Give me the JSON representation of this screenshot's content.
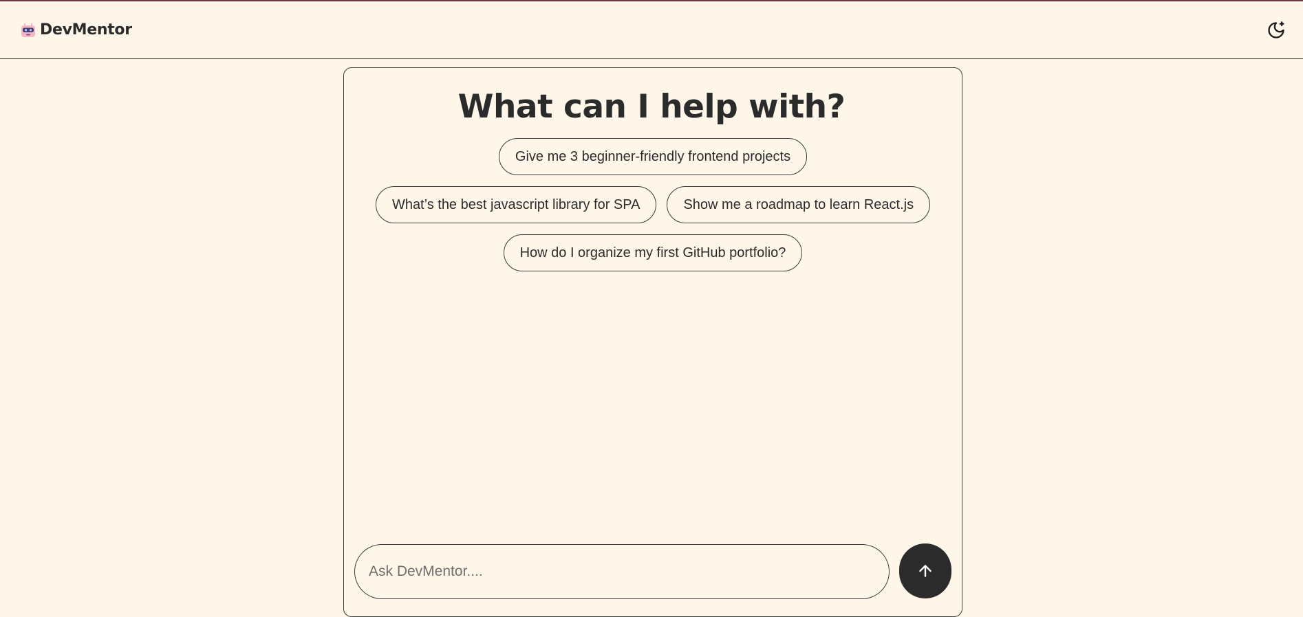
{
  "app": {
    "name": "DevMentor",
    "logo_icon": "robot-icon",
    "theme_toggle_icon": "moon-stars-icon"
  },
  "main": {
    "heading": "What can I help with?",
    "suggestions": [
      [
        "Give me 3 beginner-friendly frontend projects"
      ],
      [
        "What’s the best javascript library for SPA",
        "Show me a roadmap to learn React.js"
      ],
      [
        "How do I organize my first GitHub portfolio?"
      ]
    ]
  },
  "composer": {
    "placeholder": "Ask DevMentor....",
    "value": "",
    "send_icon": "arrow-up-icon"
  },
  "colors": {
    "background": "#fef6e9",
    "text": "#2b2b2b",
    "border": "#3a3a3a",
    "send_button": "#2b2b2b",
    "top_accent": "#6b3a4a"
  }
}
